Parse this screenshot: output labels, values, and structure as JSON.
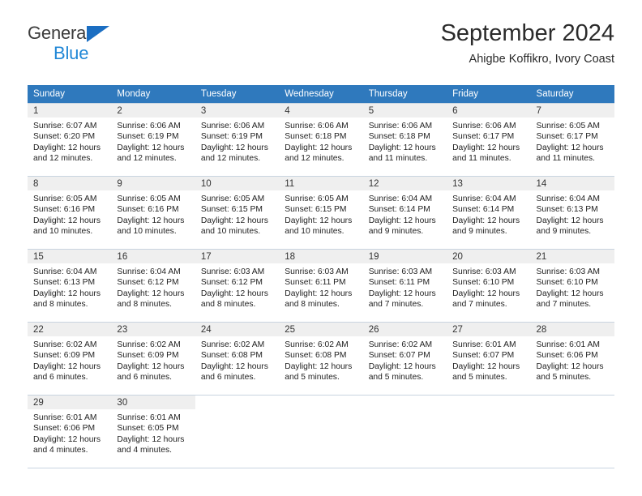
{
  "logo": {
    "line1": "General",
    "line2": "Blue",
    "triangle_color": "#1b6ec2",
    "line1_color": "#3c3c3c",
    "line2_color": "#2087d6"
  },
  "header": {
    "title": "September 2024",
    "subtitle": "Ahigbe Koffikro, Ivory Coast"
  },
  "colors": {
    "header_row_bg": "#2f79bd",
    "header_row_text": "#ffffff",
    "daynum_bg": "#efefef",
    "grid_border": "#c8d4e0"
  },
  "weekday_headers": [
    "Sunday",
    "Monday",
    "Tuesday",
    "Wednesday",
    "Thursday",
    "Friday",
    "Saturday"
  ],
  "weeks": [
    [
      {
        "day": "1",
        "sunrise": "Sunrise: 6:07 AM",
        "sunset": "Sunset: 6:20 PM",
        "daylight": "Daylight: 12 hours and 12 minutes."
      },
      {
        "day": "2",
        "sunrise": "Sunrise: 6:06 AM",
        "sunset": "Sunset: 6:19 PM",
        "daylight": "Daylight: 12 hours and 12 minutes."
      },
      {
        "day": "3",
        "sunrise": "Sunrise: 6:06 AM",
        "sunset": "Sunset: 6:19 PM",
        "daylight": "Daylight: 12 hours and 12 minutes."
      },
      {
        "day": "4",
        "sunrise": "Sunrise: 6:06 AM",
        "sunset": "Sunset: 6:18 PM",
        "daylight": "Daylight: 12 hours and 12 minutes."
      },
      {
        "day": "5",
        "sunrise": "Sunrise: 6:06 AM",
        "sunset": "Sunset: 6:18 PM",
        "daylight": "Daylight: 12 hours and 11 minutes."
      },
      {
        "day": "6",
        "sunrise": "Sunrise: 6:06 AM",
        "sunset": "Sunset: 6:17 PM",
        "daylight": "Daylight: 12 hours and 11 minutes."
      },
      {
        "day": "7",
        "sunrise": "Sunrise: 6:05 AM",
        "sunset": "Sunset: 6:17 PM",
        "daylight": "Daylight: 12 hours and 11 minutes."
      }
    ],
    [
      {
        "day": "8",
        "sunrise": "Sunrise: 6:05 AM",
        "sunset": "Sunset: 6:16 PM",
        "daylight": "Daylight: 12 hours and 10 minutes."
      },
      {
        "day": "9",
        "sunrise": "Sunrise: 6:05 AM",
        "sunset": "Sunset: 6:16 PM",
        "daylight": "Daylight: 12 hours and 10 minutes."
      },
      {
        "day": "10",
        "sunrise": "Sunrise: 6:05 AM",
        "sunset": "Sunset: 6:15 PM",
        "daylight": "Daylight: 12 hours and 10 minutes."
      },
      {
        "day": "11",
        "sunrise": "Sunrise: 6:05 AM",
        "sunset": "Sunset: 6:15 PM",
        "daylight": "Daylight: 12 hours and 10 minutes."
      },
      {
        "day": "12",
        "sunrise": "Sunrise: 6:04 AM",
        "sunset": "Sunset: 6:14 PM",
        "daylight": "Daylight: 12 hours and 9 minutes."
      },
      {
        "day": "13",
        "sunrise": "Sunrise: 6:04 AM",
        "sunset": "Sunset: 6:14 PM",
        "daylight": "Daylight: 12 hours and 9 minutes."
      },
      {
        "day": "14",
        "sunrise": "Sunrise: 6:04 AM",
        "sunset": "Sunset: 6:13 PM",
        "daylight": "Daylight: 12 hours and 9 minutes."
      }
    ],
    [
      {
        "day": "15",
        "sunrise": "Sunrise: 6:04 AM",
        "sunset": "Sunset: 6:13 PM",
        "daylight": "Daylight: 12 hours and 8 minutes."
      },
      {
        "day": "16",
        "sunrise": "Sunrise: 6:04 AM",
        "sunset": "Sunset: 6:12 PM",
        "daylight": "Daylight: 12 hours and 8 minutes."
      },
      {
        "day": "17",
        "sunrise": "Sunrise: 6:03 AM",
        "sunset": "Sunset: 6:12 PM",
        "daylight": "Daylight: 12 hours and 8 minutes."
      },
      {
        "day": "18",
        "sunrise": "Sunrise: 6:03 AM",
        "sunset": "Sunset: 6:11 PM",
        "daylight": "Daylight: 12 hours and 8 minutes."
      },
      {
        "day": "19",
        "sunrise": "Sunrise: 6:03 AM",
        "sunset": "Sunset: 6:11 PM",
        "daylight": "Daylight: 12 hours and 7 minutes."
      },
      {
        "day": "20",
        "sunrise": "Sunrise: 6:03 AM",
        "sunset": "Sunset: 6:10 PM",
        "daylight": "Daylight: 12 hours and 7 minutes."
      },
      {
        "day": "21",
        "sunrise": "Sunrise: 6:03 AM",
        "sunset": "Sunset: 6:10 PM",
        "daylight": "Daylight: 12 hours and 7 minutes."
      }
    ],
    [
      {
        "day": "22",
        "sunrise": "Sunrise: 6:02 AM",
        "sunset": "Sunset: 6:09 PM",
        "daylight": "Daylight: 12 hours and 6 minutes."
      },
      {
        "day": "23",
        "sunrise": "Sunrise: 6:02 AM",
        "sunset": "Sunset: 6:09 PM",
        "daylight": "Daylight: 12 hours and 6 minutes."
      },
      {
        "day": "24",
        "sunrise": "Sunrise: 6:02 AM",
        "sunset": "Sunset: 6:08 PM",
        "daylight": "Daylight: 12 hours and 6 minutes."
      },
      {
        "day": "25",
        "sunrise": "Sunrise: 6:02 AM",
        "sunset": "Sunset: 6:08 PM",
        "daylight": "Daylight: 12 hours and 5 minutes."
      },
      {
        "day": "26",
        "sunrise": "Sunrise: 6:02 AM",
        "sunset": "Sunset: 6:07 PM",
        "daylight": "Daylight: 12 hours and 5 minutes."
      },
      {
        "day": "27",
        "sunrise": "Sunrise: 6:01 AM",
        "sunset": "Sunset: 6:07 PM",
        "daylight": "Daylight: 12 hours and 5 minutes."
      },
      {
        "day": "28",
        "sunrise": "Sunrise: 6:01 AM",
        "sunset": "Sunset: 6:06 PM",
        "daylight": "Daylight: 12 hours and 5 minutes."
      }
    ],
    [
      {
        "day": "29",
        "sunrise": "Sunrise: 6:01 AM",
        "sunset": "Sunset: 6:06 PM",
        "daylight": "Daylight: 12 hours and 4 minutes."
      },
      {
        "day": "30",
        "sunrise": "Sunrise: 6:01 AM",
        "sunset": "Sunset: 6:05 PM",
        "daylight": "Daylight: 12 hours and 4 minutes."
      },
      {
        "day": "",
        "sunrise": "",
        "sunset": "",
        "daylight": ""
      },
      {
        "day": "",
        "sunrise": "",
        "sunset": "",
        "daylight": ""
      },
      {
        "day": "",
        "sunrise": "",
        "sunset": "",
        "daylight": ""
      },
      {
        "day": "",
        "sunrise": "",
        "sunset": "",
        "daylight": ""
      },
      {
        "day": "",
        "sunrise": "",
        "sunset": "",
        "daylight": ""
      }
    ]
  ]
}
